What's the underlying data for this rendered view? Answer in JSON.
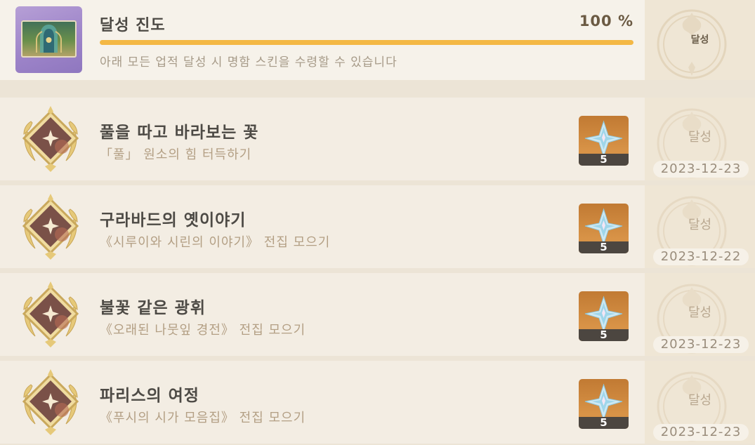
{
  "header": {
    "title": "달성 진도",
    "percent_text": "100 %",
    "progress": 1.0,
    "description": "아래 모든 업적 달성 시 명함 스킨을 수령할 수 있습니다",
    "status": "달성",
    "thumbnail_icon": "namecard-icon"
  },
  "achievements": [
    {
      "title": "풀을 따고 바라보는 꽃",
      "subtitle": "「풀」 원소의 힘 터득하기",
      "reward_icon": "primogem-icon",
      "reward_count": "5",
      "status": "달성",
      "date": "2023-12-23"
    },
    {
      "title": "구라바드의 옛이야기",
      "subtitle": "《시루이와 시린의 이야기》 전집 모으기",
      "reward_icon": "primogem-icon",
      "reward_count": "5",
      "status": "달성",
      "date": "2023-12-22"
    },
    {
      "title": "불꽃 같은 광휘",
      "subtitle": "《오래된 나뭇잎 경전》 전집 모으기",
      "reward_icon": "primogem-icon",
      "reward_count": "5",
      "status": "달성",
      "date": "2023-12-23"
    },
    {
      "title": "파리스의 여정",
      "subtitle": "《푸시의 시가 모음집》 전집 모으기",
      "reward_icon": "primogem-icon",
      "reward_count": "5",
      "status": "달성",
      "date": "2023-12-23"
    }
  ],
  "colors": {
    "progress_fill": "#f4b844",
    "reward_bg": "#d08a3e",
    "medal_gold": "#e2c47a"
  }
}
